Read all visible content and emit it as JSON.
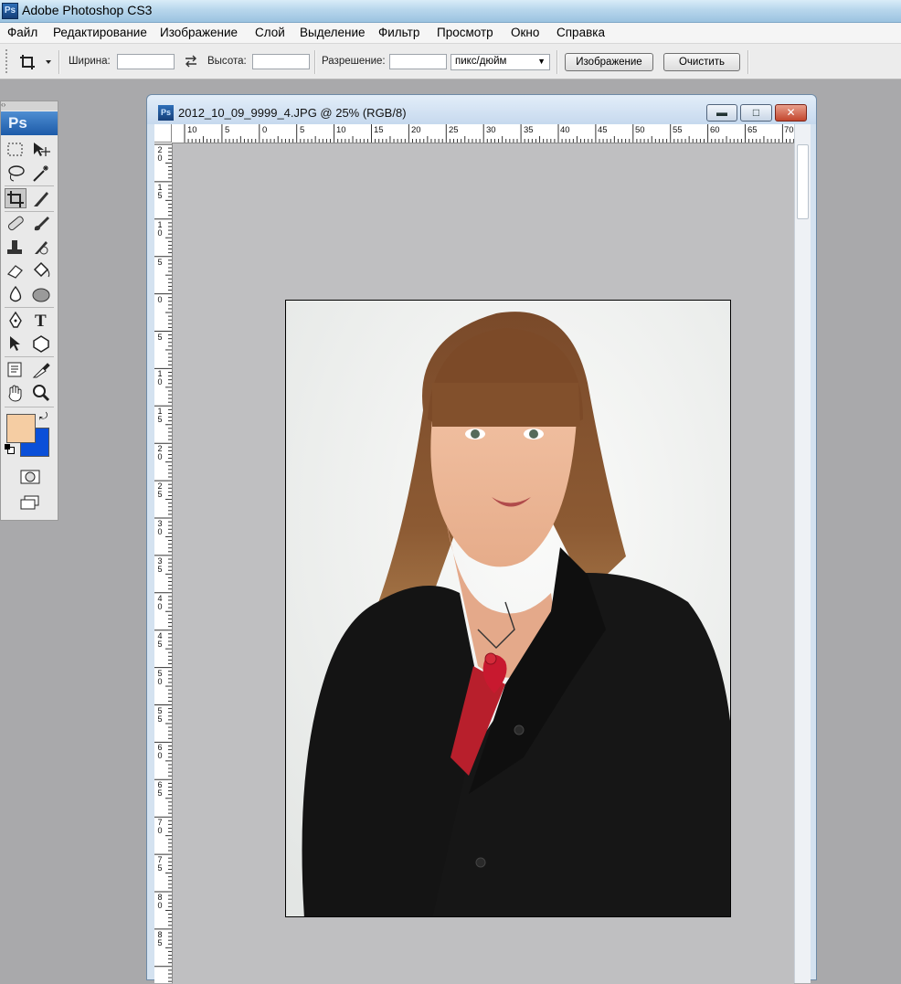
{
  "app": {
    "title": "Adobe Photoshop CS3",
    "icon_label": "Ps"
  },
  "menu": {
    "items": [
      "Файл",
      "Редактирование",
      "Изображение",
      "Слой",
      "Выделение",
      "Фильтр",
      "Просмотр",
      "Окно",
      "Справка"
    ]
  },
  "options": {
    "width_label": "Ширина:",
    "width_value": "",
    "height_label": "Высота:",
    "height_value": "",
    "resolution_label": "Разрешение:",
    "resolution_value": "",
    "unit_value": "пикс/дюйм",
    "image_button": "Изображение",
    "clear_button": "Очистить",
    "swap_icon": "swap-arrows-icon",
    "tool_icon": "crop-icon"
  },
  "tools": {
    "logo": "Ps",
    "foreground_color": "#f5cda3",
    "background_color": "#0b4fd8",
    "active_tool": "crop-tool"
  },
  "document": {
    "title": "2012_10_09_9999_4.JPG @ 25% (RGB/8)",
    "icon_label": "Ps",
    "minimize_label": "▬",
    "maximize_label": "□",
    "close_label": "✕"
  },
  "rulers": {
    "horizontal": [
      "10",
      "5",
      "0",
      "5",
      "10",
      "15",
      "20",
      "25",
      "30",
      "35",
      "40",
      "45",
      "50",
      "55",
      "60",
      "65",
      "70"
    ],
    "vertical": [
      "2\n0",
      "1\n5",
      "1\n0",
      "5",
      "0",
      "5",
      "1\n0",
      "1\n5",
      "2\n0",
      "2\n5",
      "3\n0",
      "3\n5",
      "4\n0",
      "4\n5",
      "5\n0",
      "5\n5",
      "6\n0",
      "6\n5",
      "7\n0",
      "7\n5",
      "8\n0",
      "8\n5"
    ]
  },
  "colors": {
    "titlebar": "#b7d6ec",
    "canvas_bg": "#bfbfc1",
    "workspace_bg": "#a9a9ab"
  }
}
